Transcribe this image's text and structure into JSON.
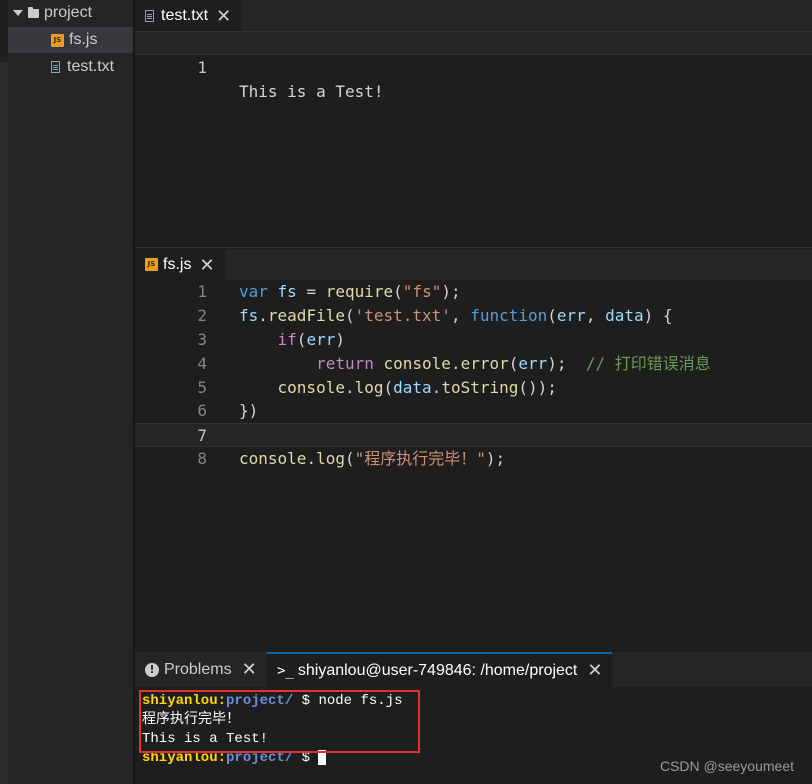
{
  "explorer": {
    "folder": "project",
    "files": [
      {
        "name": "fs.js",
        "icon": "js-file-icon",
        "selected": true
      },
      {
        "name": "test.txt",
        "icon": "text-file-icon",
        "selected": false
      }
    ]
  },
  "editor_top": {
    "tab_label": "test.txt",
    "lines": [
      {
        "num": "1",
        "text": "This is a Test!"
      }
    ]
  },
  "editor_bottom": {
    "tab_label": "fs.js",
    "lines": [
      {
        "num": "1",
        "tokens": [
          [
            "kw",
            "var"
          ],
          [
            "pl",
            " "
          ],
          [
            "var",
            "fs"
          ],
          [
            "pl",
            " = "
          ],
          [
            "fn",
            "require"
          ],
          [
            "pl",
            "("
          ],
          [
            "str",
            "\"fs\""
          ],
          [
            "pl",
            ");"
          ]
        ]
      },
      {
        "num": "2",
        "tokens": [
          [
            "var",
            "fs"
          ],
          [
            "pl",
            "."
          ],
          [
            "fn",
            "readFile"
          ],
          [
            "pl",
            "("
          ],
          [
            "str",
            "'test.txt'"
          ],
          [
            "pl",
            ", "
          ],
          [
            "kw",
            "function"
          ],
          [
            "pl",
            "("
          ],
          [
            "var",
            "err"
          ],
          [
            "pl",
            ", "
          ],
          [
            "var",
            "data"
          ],
          [
            "pl",
            ") {"
          ]
        ]
      },
      {
        "num": "3",
        "tokens": [
          [
            "pl",
            "    "
          ],
          [
            "ctl",
            "if"
          ],
          [
            "pl",
            "("
          ],
          [
            "var",
            "err"
          ],
          [
            "pl",
            ")"
          ]
        ]
      },
      {
        "num": "4",
        "tokens": [
          [
            "pl",
            "        "
          ],
          [
            "ctl",
            "return"
          ],
          [
            "pl",
            " "
          ],
          [
            "fn",
            "console"
          ],
          [
            "pl",
            "."
          ],
          [
            "fn",
            "error"
          ],
          [
            "pl",
            "("
          ],
          [
            "var",
            "err"
          ],
          [
            "pl",
            ");  "
          ],
          [
            "cmt",
            "// 打印错误消息"
          ]
        ]
      },
      {
        "num": "5",
        "tokens": [
          [
            "pl",
            "    "
          ],
          [
            "fn",
            "console"
          ],
          [
            "pl",
            "."
          ],
          [
            "fn",
            "log"
          ],
          [
            "pl",
            "("
          ],
          [
            "var",
            "data"
          ],
          [
            "pl",
            "."
          ],
          [
            "fn",
            "toString"
          ],
          [
            "pl",
            "());"
          ]
        ]
      },
      {
        "num": "6",
        "tokens": [
          [
            "pl",
            "})"
          ]
        ]
      },
      {
        "num": "7",
        "tokens": [],
        "current": true
      },
      {
        "num": "8",
        "tokens": [
          [
            "fn",
            "console"
          ],
          [
            "pl",
            "."
          ],
          [
            "fn",
            "log"
          ],
          [
            "pl",
            "("
          ],
          [
            "str",
            "\"程序执行完毕！\""
          ],
          [
            "pl",
            ");"
          ]
        ]
      }
    ]
  },
  "panel": {
    "problems_label": "Problems",
    "terminal_label": "shiyanlou@user-749846: /home/project",
    "terminal_lines": [
      {
        "user": "shiyanlou",
        "sep": ":",
        "path": "project/",
        "rest": " $ node fs.js"
      },
      {
        "text": "程序执行完毕！"
      },
      {
        "text": "This is a Test!"
      },
      {
        "user": "shiyanlou",
        "sep": ":",
        "path": "project/",
        "rest": " $ ",
        "cursor": true
      }
    ]
  },
  "watermark": "CSDN @seeyoumeet",
  "colors": {
    "keyword": "#569cd6",
    "function": "#dcdcaa",
    "variable": "#9cdcfe",
    "string": "#ce9178",
    "comment": "#6a9955",
    "control": "#c586c0",
    "terminal_user": "#ffd700",
    "terminal_path": "#6b8fd6",
    "highlight_box": "#e0342c"
  }
}
